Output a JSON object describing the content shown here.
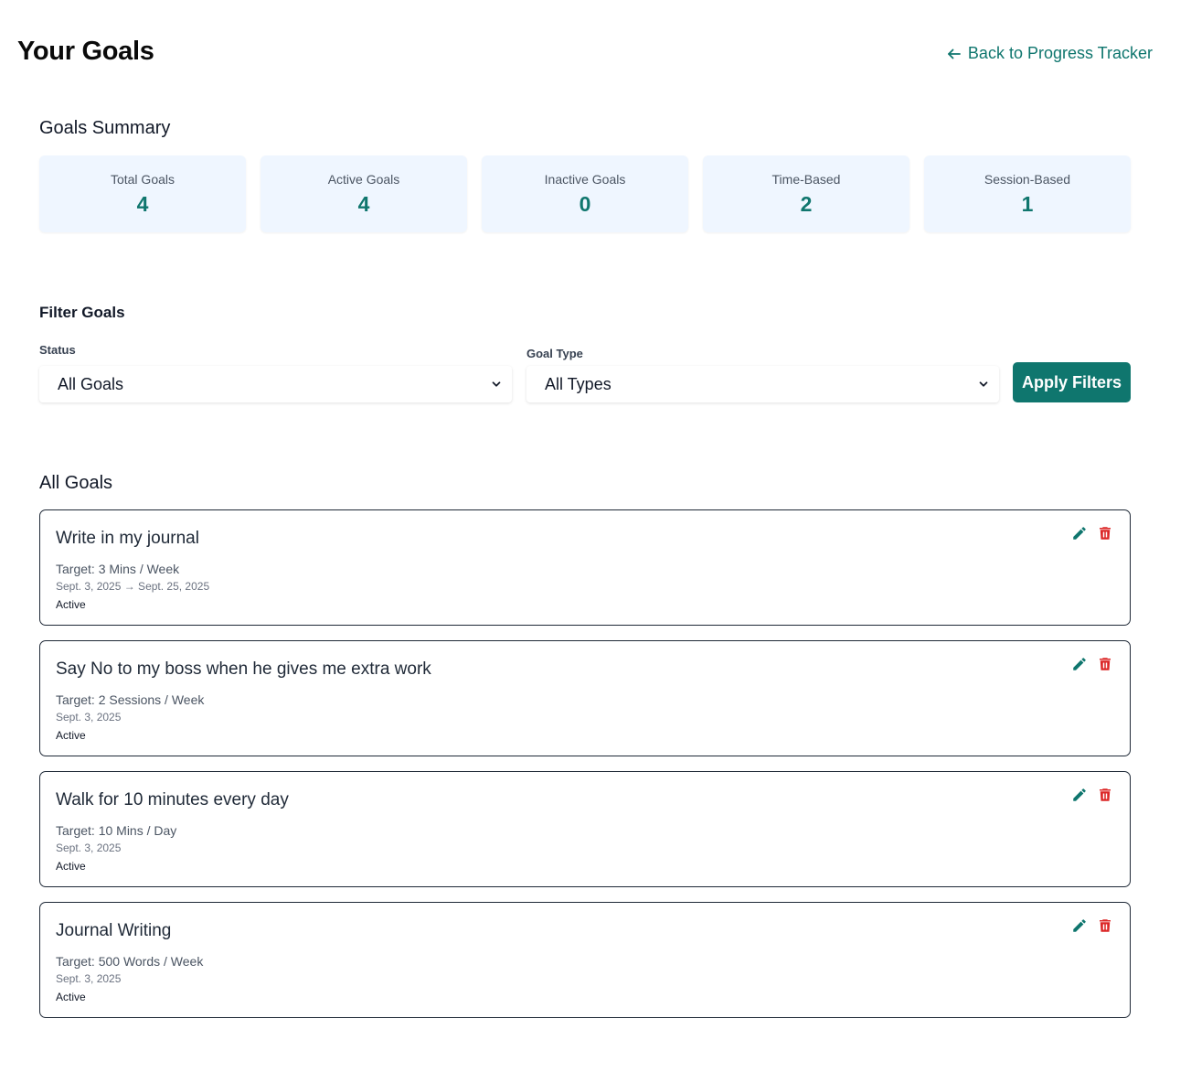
{
  "header": {
    "title": "Your Goals",
    "back_link": "Back to Progress Tracker"
  },
  "summary": {
    "title": "Goals Summary",
    "stats": [
      {
        "label": "Total Goals",
        "value": "4"
      },
      {
        "label": "Active Goals",
        "value": "4"
      },
      {
        "label": "Inactive Goals",
        "value": "0"
      },
      {
        "label": "Time-Based",
        "value": "2"
      },
      {
        "label": "Session-Based",
        "value": "1"
      }
    ]
  },
  "filters": {
    "title": "Filter Goals",
    "status_label": "Status",
    "status_value": "All Goals",
    "type_label": "Goal Type",
    "type_value": "All Types",
    "apply_label": "Apply Filters"
  },
  "goals": {
    "title": "All Goals",
    "items": [
      {
        "title": "Write in my journal",
        "target": "Target: 3 Mins / Week",
        "dates": "Sept. 3, 2025 → Sept. 25, 2025",
        "status": "Active"
      },
      {
        "title": "Say No to my boss when he gives me extra work",
        "target": "Target: 2 Sessions / Week",
        "dates": "Sept. 3, 2025",
        "status": "Active"
      },
      {
        "title": "Walk for 10 minutes every day",
        "target": "Target: 10 Mins / Day",
        "dates": "Sept. 3, 2025",
        "status": "Active"
      },
      {
        "title": "Journal Writing",
        "target": "Target: 500 Words / Week",
        "dates": "Sept. 3, 2025",
        "status": "Active"
      }
    ]
  },
  "colors": {
    "accent": "#0f766e",
    "card_bg": "#eff6ff",
    "delete": "#dc2626"
  },
  "icons": {
    "back": "arrow-left-icon",
    "select": "chevron-down-icon",
    "edit": "pencil-icon",
    "delete": "trash-icon"
  }
}
